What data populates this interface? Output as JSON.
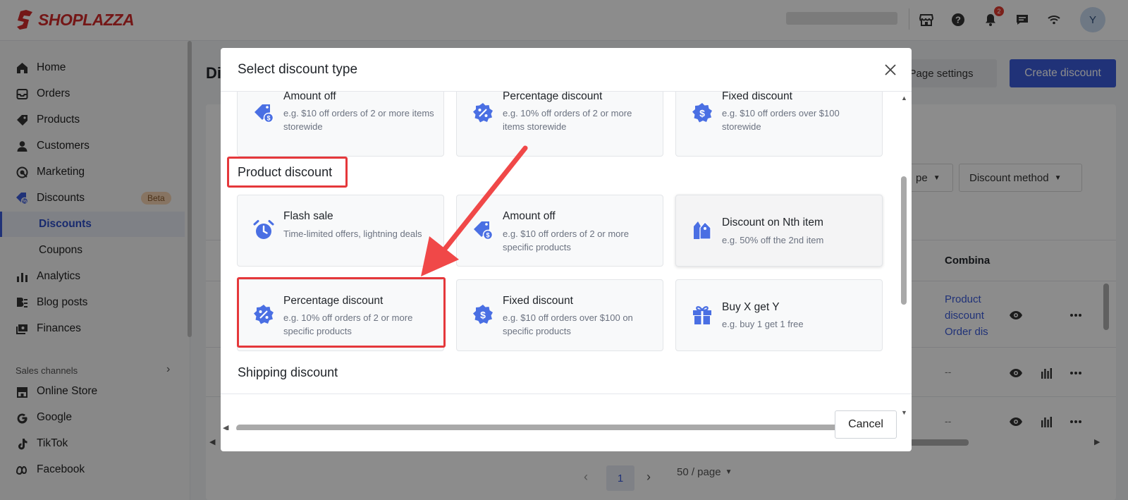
{
  "brand": {
    "name": "SHOPLAZZA",
    "color": "#d42b2b"
  },
  "topbar": {
    "notification_count": "2",
    "avatar_initial": "Y",
    "icons": [
      "store-icon",
      "help-icon",
      "bell-icon",
      "chat-icon",
      "wifi-icon"
    ]
  },
  "sidebar": {
    "items": [
      {
        "label": "Home",
        "icon": "home-icon"
      },
      {
        "label": "Orders",
        "icon": "orders-icon"
      },
      {
        "label": "Products",
        "icon": "tag-icon"
      },
      {
        "label": "Customers",
        "icon": "person-icon"
      },
      {
        "label": "Marketing",
        "icon": "marketing-icon"
      },
      {
        "label": "Discounts",
        "icon": "discount-icon",
        "badge": "Beta"
      },
      {
        "label": "Discounts",
        "sub": true,
        "active": true
      },
      {
        "label": "Coupons",
        "sub": true
      },
      {
        "label": "Analytics",
        "icon": "analytics-icon"
      },
      {
        "label": "Blog posts",
        "icon": "blog-icon"
      },
      {
        "label": "Finances",
        "icon": "finances-icon"
      }
    ],
    "sales_channels_label": "Sales channels",
    "channels": [
      {
        "label": "Online Store",
        "icon": "store-icon"
      },
      {
        "label": "Google",
        "icon": "google-icon"
      },
      {
        "label": "TikTok",
        "icon": "tiktok-icon"
      },
      {
        "label": "Facebook",
        "icon": "meta-icon"
      }
    ]
  },
  "main": {
    "title_partial": "Di",
    "page_settings_label": "Page settings",
    "create_discount_label": "Create discount",
    "filter_type_partial": "pe",
    "filter_method_label": "Discount method",
    "column_combination_partial": "Combina",
    "row1_links": [
      "Product",
      "discount",
      "Order dis"
    ],
    "row_dash": "--",
    "pagination": {
      "current_page": "1",
      "page_size": "50 / page"
    }
  },
  "modal": {
    "title": "Select discount type",
    "cancel_label": "Cancel",
    "order_options": [
      {
        "title": "Amount off",
        "desc": "e.g. $10 off orders of 2 or more items storewide",
        "icon": "tag-dollar-icon"
      },
      {
        "title": "Percentage discount",
        "desc": "e.g. 10% off orders of 2 or more items storewide",
        "icon": "percent-badge-icon"
      },
      {
        "title": "Fixed discount",
        "desc": "e.g. $10 off orders over $100 storewide",
        "icon": "dollar-badge-icon"
      }
    ],
    "product_section_title": "Product discount",
    "product_options": [
      {
        "title": "Flash sale",
        "desc": "Time-limited offers, lightning deals",
        "icon": "alarm-clock-icon"
      },
      {
        "title": "Amount off",
        "desc": "e.g. $10 off orders of 2 or more specific products",
        "icon": "tag-dollar-icon"
      },
      {
        "title": "Discount on Nth item",
        "desc": "e.g. 50% off the 2nd item",
        "icon": "double-tag-icon"
      },
      {
        "title": "Percentage discount",
        "desc": "e.g. 10% off orders of 2 or more specific products",
        "icon": "percent-badge-icon"
      },
      {
        "title": "Fixed discount",
        "desc": "e.g. $10 off orders over $100 on specific products",
        "icon": "dollar-badge-icon"
      },
      {
        "title": "Buy X get Y",
        "desc": "e.g. buy 1 get 1 free",
        "icon": "gift-icon"
      }
    ],
    "shipping_section_title": "Shipping discount"
  },
  "colors": {
    "accent": "#3b5bdb",
    "icon_blue": "#4a6fe3",
    "highlight_red": "#e5383b"
  }
}
